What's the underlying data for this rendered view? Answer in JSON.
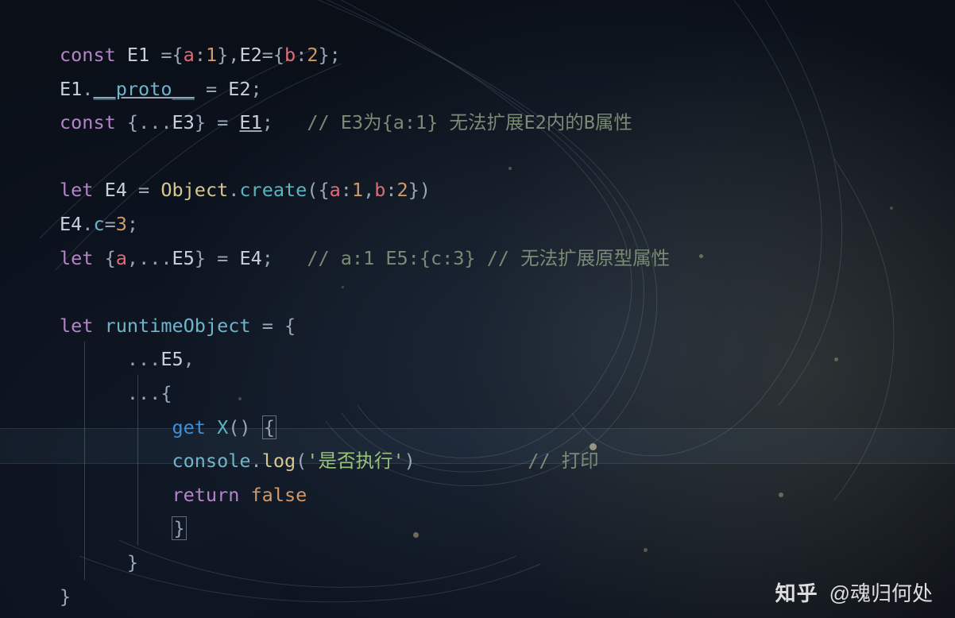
{
  "watermark": {
    "site": "知乎",
    "handle": "@魂归何处"
  },
  "code": {
    "l1": {
      "kw": "const",
      "sp": " ",
      "v1": "E1",
      "eq": " =",
      "br1": "{",
      "p1": "a",
      "c1": ":",
      "n1": "1",
      "br1c": "}",
      "comma": ",",
      "v2": "E2",
      "eq2": "=",
      "br2": "{",
      "p2": "b",
      "c2": ":",
      "n2": "2",
      "br2c": "}",
      "sc": ";"
    },
    "l2": {
      "v": "E1",
      "dot": ".",
      "proto": "__proto__",
      "eq": " = ",
      "v2": "E2",
      "sc": ";"
    },
    "l3": {
      "kw": "const",
      "sp": " ",
      "br": "{",
      "spread": "...",
      "v": "E3",
      "brc": "}",
      "eq": " = ",
      "rv": "E1",
      "sc": ";",
      "pad": "   ",
      "cmt": "// E3为{a:1} 无法扩展E2内的B属性"
    },
    "l5": {
      "kw": "let",
      "sp": " ",
      "v": "E4",
      "eq": " = ",
      "obj": "Object",
      "dot": ".",
      "fn": "create",
      "op": "(",
      "br": "{",
      "p1": "a",
      "c1": ":",
      "n1": "1",
      "comma": ",",
      "p2": "b",
      "c2": ":",
      "n2": "2",
      "brc": "}",
      "cp": ")"
    },
    "l6": {
      "v": "E4",
      "dot": ".",
      "p": "c",
      "eq": "=",
      "n": "3",
      "sc": ";"
    },
    "l7": {
      "kw": "let",
      "sp": " ",
      "br": "{",
      "p": "a",
      "comma": ",",
      "spread": "...",
      "v": "E5",
      "brc": "}",
      "eq": " = ",
      "rv": "E4",
      "sc": ";",
      "pad": "   ",
      "cmt": "// a:1 E5:{c:3} // 无法扩展原型属性"
    },
    "l9": {
      "kw": "let",
      "sp": " ",
      "v": "runtimeObject",
      "eq": " = ",
      "br": "{"
    },
    "l10": {
      "indent": "      ",
      "spread": "...",
      "v": "E5",
      "comma": ","
    },
    "l11": {
      "indent": "      ",
      "spread": "...",
      "br": "{"
    },
    "l12": {
      "indent": "          ",
      "kw": "get",
      "sp": " ",
      "fn": "X",
      "par": "()",
      "sp2": " ",
      "br": "{"
    },
    "l13": {
      "indent": "          ",
      "obj": "console",
      "dot": ".",
      "fn": "log",
      "op": "(",
      "str": "'是否执行'",
      "cp": ")",
      "pad": "          ",
      "cmt": "// 打印"
    },
    "l14": {
      "indent": "          ",
      "kw": "return",
      "sp": " ",
      "val": "false"
    },
    "l15": {
      "indent": "          ",
      "br": "}"
    },
    "l16": {
      "indent": "      ",
      "br": "}"
    },
    "l17": {
      "indent": "",
      "br": "}"
    }
  }
}
